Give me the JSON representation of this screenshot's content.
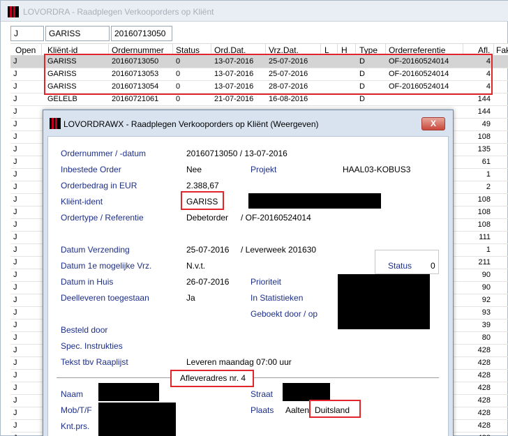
{
  "background_window": {
    "title": "LOVORDRA - Raadplegen Verkooporders op Kliënt",
    "search": {
      "open": "J",
      "client": "GARISS",
      "order": "20160713050"
    },
    "columns": [
      "Open",
      "Kliënt-id",
      "Ordernummer",
      "Status",
      "Ord.Dat.",
      "Vrz.Dat.",
      "L",
      "H",
      "Type",
      "Orderreferentie",
      "Afl.",
      "Fak"
    ],
    "rows": [
      {
        "open": "J",
        "client": "GARISS",
        "order": "20160713050",
        "status": "0",
        "orddat": "13-07-2016",
        "vrzdat": "25-07-2016",
        "type": "D",
        "ref": "OF-20160524014",
        "afl": "4"
      },
      {
        "open": "J",
        "client": "GARISS",
        "order": "20160713053",
        "status": "0",
        "orddat": "13-07-2016",
        "vrzdat": "25-07-2016",
        "type": "D",
        "ref": "OF-20160524014",
        "afl": "4"
      },
      {
        "open": "J",
        "client": "GARISS",
        "order": "20160713054",
        "status": "0",
        "orddat": "13-07-2016",
        "vrzdat": "28-07-2016",
        "type": "D",
        "ref": "OF-20160524014",
        "afl": "4"
      },
      {
        "open": "J",
        "client": "GELELB",
        "order": "20160721061",
        "status": "0",
        "orddat": "21-07-2016",
        "vrzdat": "16-08-2016",
        "type": "D",
        "ref": "",
        "afl": "144"
      },
      {
        "open": "J",
        "afl": "144"
      },
      {
        "open": "J",
        "afl": "49"
      },
      {
        "open": "J",
        "afl": "108"
      },
      {
        "open": "J",
        "afl": "135"
      },
      {
        "open": "J",
        "afl": "61"
      },
      {
        "open": "J",
        "afl": "1"
      },
      {
        "open": "J",
        "afl": "2"
      },
      {
        "open": "J",
        "afl": "108"
      },
      {
        "open": "J",
        "afl": "108"
      },
      {
        "open": "J",
        "afl": "108"
      },
      {
        "open": "J",
        "afl": "111"
      },
      {
        "open": "J",
        "afl": "1"
      },
      {
        "open": "J",
        "afl": "211"
      },
      {
        "open": "J",
        "afl": "90"
      },
      {
        "open": "J",
        "afl": "90"
      },
      {
        "open": "J",
        "afl": "92"
      },
      {
        "open": "J",
        "afl": "93"
      },
      {
        "open": "J",
        "afl": "39"
      },
      {
        "open": "J",
        "afl": "80"
      },
      {
        "open": "J",
        "afl": "428"
      },
      {
        "open": "J",
        "afl": "428"
      },
      {
        "open": "J",
        "afl": "428"
      },
      {
        "open": "J",
        "afl": "428"
      },
      {
        "open": "J",
        "afl": "428"
      },
      {
        "open": "J",
        "afl": "428"
      },
      {
        "open": "J",
        "afl": "428"
      },
      {
        "open": "J",
        "afl": "428"
      }
    ]
  },
  "dialog": {
    "title": "LOVORDRAWX - Raadplegen Verkooporders op Kliënt (Weergeven)",
    "close_label": "X",
    "fields": {
      "ordernummer_label": "Ordernummer / -datum",
      "ordernummer_value": "20160713050 / 13-07-2016",
      "inbestede_label": "Inbestede Order",
      "inbestede_value": "Nee",
      "projekt_label": "Projekt",
      "projekt_value": "HAAL03-KOBUS3",
      "orderbedrag_label": "Orderbedrag in EUR",
      "orderbedrag_value": "2.388,67",
      "klient_label": "Kliënt-ident",
      "klient_value": "GARISS",
      "ordertype_label": "Ordertype / Referentie",
      "ordertype_value": "Debetorder",
      "referentie_value": "/ OF-20160524014",
      "datum_verzending_label": "Datum Verzending",
      "datum_verzending_value": "25-07-2016",
      "leverweek_value": "/ Leverweek 201630",
      "datum_1e_label": "Datum 1e mogelijke Vrz.",
      "datum_1e_value": "N.v.t.",
      "status_label": "Status",
      "status_value": "0",
      "datum_huis_label": "Datum in Huis",
      "datum_huis_value": "26-07-2016",
      "prioriteit_label": "Prioriteit",
      "deelleveren_label": "Deelleveren toegestaan",
      "deelleveren_value": "Ja",
      "statistieken_label": "In Statistieken",
      "geboekt_label": "Geboekt door / op",
      "besteld_label": "Besteld door",
      "spec_label": "Spec. Instrukties",
      "tekst_label": "Tekst tbv Raaplijst",
      "tekst_value": "Leveren maandag 07:00 uur",
      "afleveradres_label": "Afleveradres nr. 4",
      "naam_label": "Naam",
      "straat_label": "Straat",
      "mob_label": "Mob/T/F",
      "plaats_label": "Plaats",
      "plaats_value": "Aalten",
      "land_value": "Duitsland",
      "kntprs_label": "Knt.prs."
    }
  },
  "colors": {
    "highlight": "#e0262b",
    "label_blue": "#1c2e8a",
    "dialog_frame": "#d8e3ef"
  }
}
